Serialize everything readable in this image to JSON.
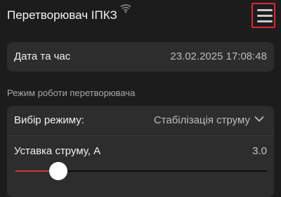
{
  "header": {
    "title": "Перетворювач ІПКЗ",
    "status_icon": "wifi-icon",
    "menu_icon": "hamburger-menu-icon",
    "menu_highlight_color": "#e0282c"
  },
  "datetime": {
    "label": "Дата та час",
    "value": "23.02.2025 17:08:48"
  },
  "mode_section": {
    "title": "Режим роботи перетворювача",
    "mode_select": {
      "label": "Вибір режиму:",
      "selected": "Стабілізація струму"
    },
    "current_setpoint": {
      "label": "Уставка струму, А",
      "value": "3.0",
      "fraction": 0.17,
      "fill_color": "#d43a3a"
    }
  }
}
